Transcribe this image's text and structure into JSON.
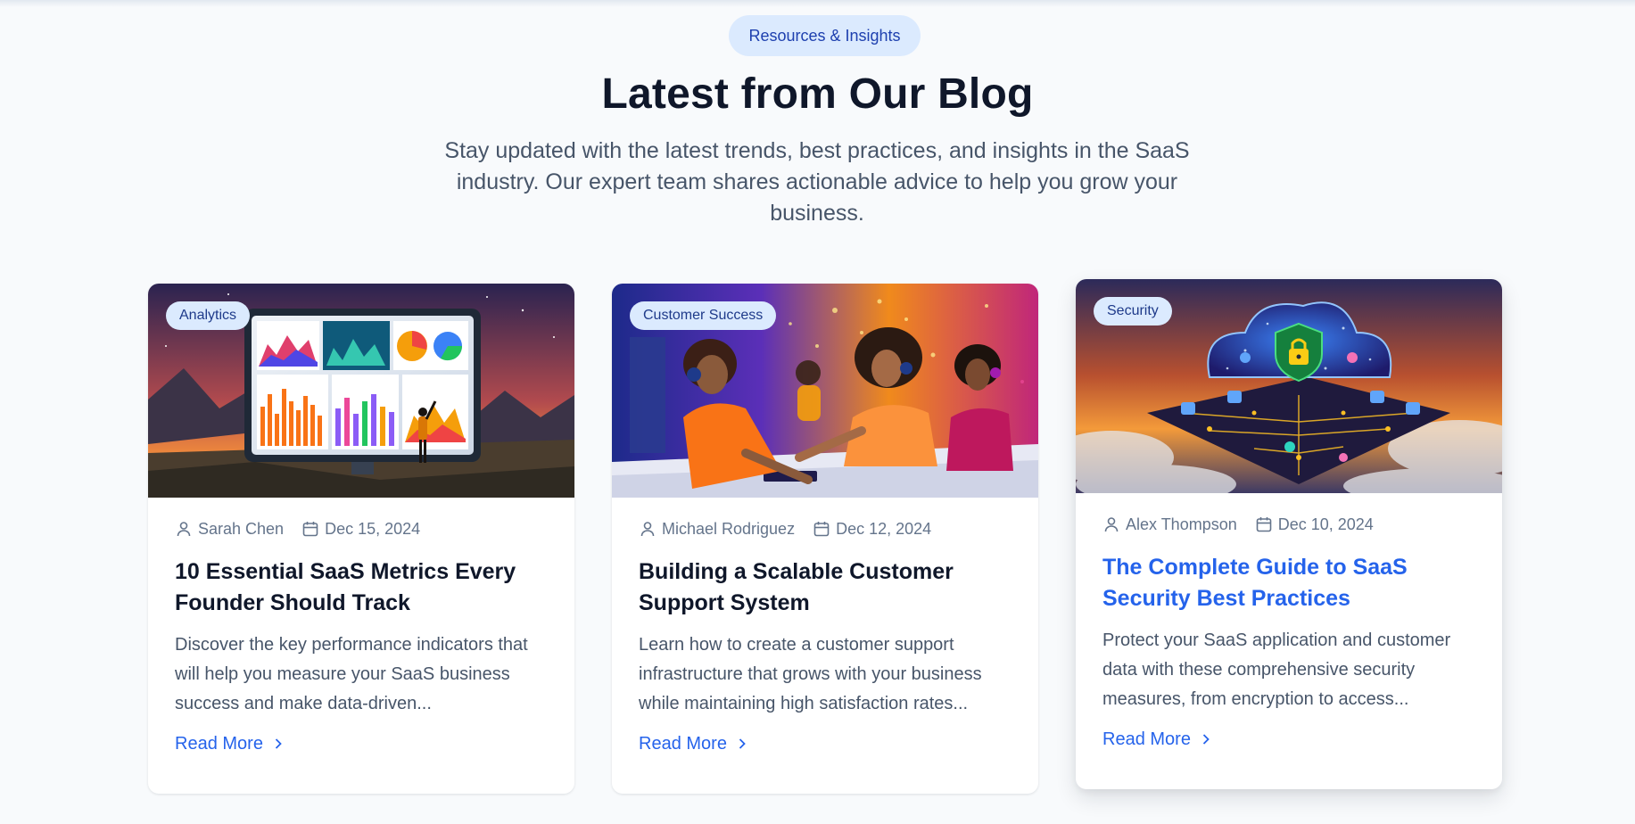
{
  "section": {
    "eyebrow": "Resources & Insights",
    "title": "Latest from Our Blog",
    "subtitle": "Stay updated with the latest trends, best practices, and insights in the SaaS industry. Our expert team shares actionable advice to help you grow your business."
  },
  "posts": [
    {
      "category": "Analytics",
      "author": "Sarah Chen",
      "date": "Dec 15, 2024",
      "title": "10 Essential SaaS Metrics Every Founder Should Track",
      "excerpt": "Discover the key performance indicators that will help you measure your SaaS business success and make data-driven...",
      "cta": "Read More"
    },
    {
      "category": "Customer Success",
      "author": "Michael Rodriguez",
      "date": "Dec 12, 2024",
      "title": "Building a Scalable Customer Support System",
      "excerpt": "Learn how to create a customer support infrastructure that grows with your business while maintaining high satisfaction rates...",
      "cta": "Read More"
    },
    {
      "category": "Security",
      "author": "Alex Thompson",
      "date": "Dec 10, 2024",
      "title": "The Complete Guide to SaaS Security Best Practices",
      "excerpt": "Protect your SaaS application and customer data with these comprehensive security measures, from encryption to access...",
      "cta": "Read More"
    }
  ],
  "icons": {
    "author": "user-icon",
    "date": "calendar-icon",
    "cta": "chevron-right-icon"
  },
  "colors": {
    "accent": "#2563eb",
    "tag_bg": "#dbeafe",
    "page_bg": "#f8fafc"
  }
}
